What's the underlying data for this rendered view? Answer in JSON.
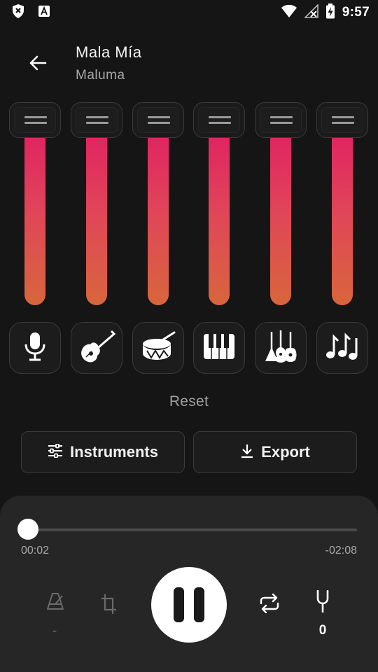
{
  "status_bar": {
    "time": "9:57",
    "icons": [
      "shield-x-icon",
      "font-a-icon",
      "wifi-icon",
      "no-signal-icon",
      "battery-charging-icon"
    ]
  },
  "header": {
    "back_icon": "arrow-left-icon",
    "title": "Mala Mía",
    "artist": "Maluma"
  },
  "mixer": {
    "track_colors": {
      "top": "#e01e63",
      "bottom": "#d8663c"
    },
    "sliders": [
      {
        "name": "vocals",
        "level": 1.0
      },
      {
        "name": "bass",
        "level": 1.0
      },
      {
        "name": "drums",
        "level": 1.0
      },
      {
        "name": "piano",
        "level": 1.0
      },
      {
        "name": "other",
        "level": 1.0
      },
      {
        "name": "instruments",
        "level": 1.0
      }
    ],
    "instrument_icons": [
      "microphone-icon",
      "guitar-icon",
      "drum-icon",
      "piano-keys-icon",
      "guitars-icon",
      "music-notes-icon"
    ],
    "reset_label": "Reset"
  },
  "actions": {
    "instruments_label": "Instruments",
    "export_label": "Export"
  },
  "player": {
    "current_time": "00:02",
    "remaining_time": "-02:08",
    "progress": 0.01,
    "metronome_value": "-",
    "tuning_value": "0",
    "accent": "#ffffff"
  }
}
